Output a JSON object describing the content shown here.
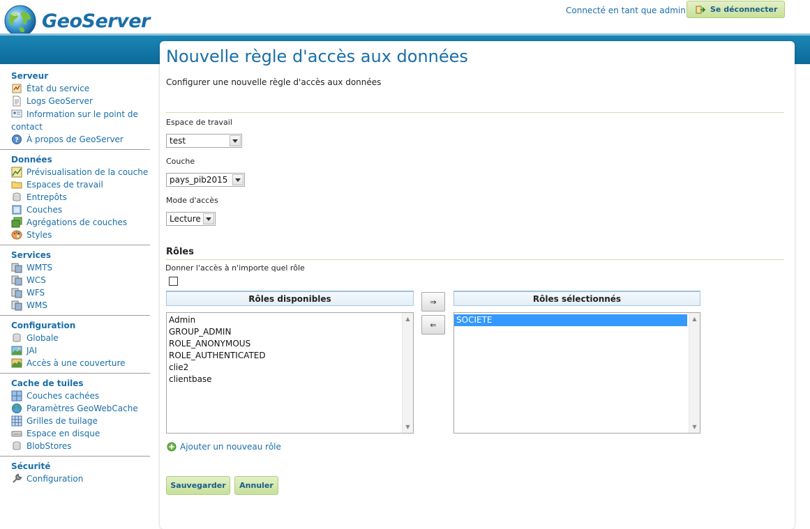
{
  "header": {
    "brand": "GeoServer",
    "login_text": "Connecté en tant que admin.",
    "logout_label": "Se déconnecter"
  },
  "sidebar": {
    "sections": [
      {
        "title": "Serveur",
        "items": [
          {
            "label": "État du service",
            "icon": "server-status-icon"
          },
          {
            "label": "Logs GeoServer",
            "icon": "log-document-icon"
          },
          {
            "label": "Information sur le point de contact",
            "icon": "contact-card-icon"
          },
          {
            "label": "À propos de GeoServer",
            "icon": "help-icon"
          }
        ]
      },
      {
        "title": "Données",
        "items": [
          {
            "label": "Prévisualisation de la couche",
            "icon": "layer-preview-icon"
          },
          {
            "label": "Espaces de travail",
            "icon": "folder-icon"
          },
          {
            "label": "Entrepôts",
            "icon": "database-icon"
          },
          {
            "label": "Couches",
            "icon": "layer-icon"
          },
          {
            "label": "Agrégations de couches",
            "icon": "layer-group-icon"
          },
          {
            "label": "Styles",
            "icon": "palette-icon"
          }
        ]
      },
      {
        "title": "Services",
        "items": [
          {
            "label": "WMTS",
            "icon": "service-icon"
          },
          {
            "label": "WCS",
            "icon": "service-icon"
          },
          {
            "label": "WFS",
            "icon": "service-icon"
          },
          {
            "label": "WMS",
            "icon": "service-icon"
          }
        ]
      },
      {
        "title": "Configuration",
        "items": [
          {
            "label": "Globale",
            "icon": "database-icon"
          },
          {
            "label": "JAI",
            "icon": "image-icon"
          },
          {
            "label": "Accès à une couverture",
            "icon": "coverage-icon"
          }
        ]
      },
      {
        "title": "Cache de tuiles",
        "items": [
          {
            "label": "Couches cachées",
            "icon": "tile-layers-icon"
          },
          {
            "label": "Paramètres GeoWebCache",
            "icon": "globe-icon"
          },
          {
            "label": "Grilles de tuilage",
            "icon": "grid-icon"
          },
          {
            "label": "Espace en disque",
            "icon": "disk-icon"
          },
          {
            "label": "BlobStores",
            "icon": "database-icon"
          }
        ]
      },
      {
        "title": "Sécurité",
        "items": [
          {
            "label": "Configuration",
            "icon": "wrench-icon"
          }
        ]
      }
    ]
  },
  "main": {
    "title": "Nouvelle règle d'accès aux données",
    "description": "Configurer une nouvelle règle d'accès aux données",
    "workspace": {
      "label": "Espace de travail",
      "value": "test"
    },
    "layer": {
      "label": "Couche",
      "value": "pays_pib2015"
    },
    "access_mode": {
      "label": "Mode d'accès",
      "value": "Lecture"
    },
    "roles": {
      "title": "Rôles",
      "any_role_label": "Donner l'accès à n'importe quel rôle",
      "available_header": "Rôles disponibles",
      "selected_header": "Rôles sélectionnés",
      "available": [
        "Admin",
        "GROUP_ADMIN",
        "ROLE_ANONYMOUS",
        "ROLE_AUTHENTICATED",
        "clie2",
        "clientbase"
      ],
      "selected": [
        "SOCIETE"
      ],
      "move_right": "⇒",
      "move_left": "⇐",
      "add_role_label": "Ajouter un nouveau rôle"
    },
    "save_label": "Sauvegarder",
    "cancel_label": "Annuler"
  },
  "colors": {
    "link": "#1a6ea8",
    "band": "#0c6a98",
    "button_green": "#c7e09a",
    "selection": "#3399ff"
  }
}
